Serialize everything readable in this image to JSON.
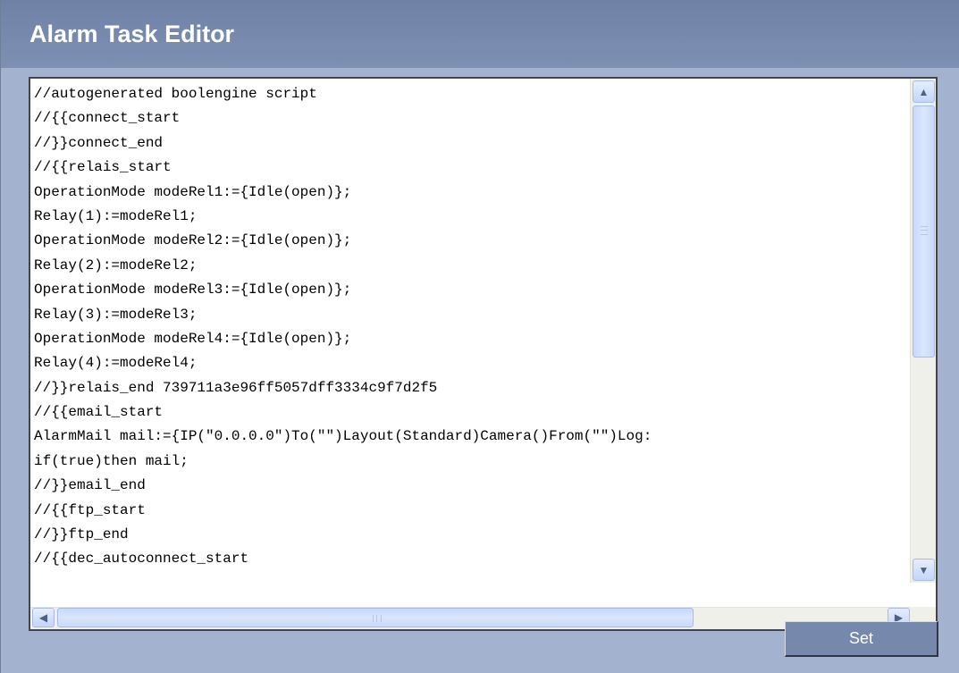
{
  "header": {
    "title": "Alarm Task Editor"
  },
  "editor": {
    "lines": [
      "//autogenerated boolengine script",
      "//{{connect_start",
      "//}}connect_end",
      "//{{relais_start",
      "OperationMode modeRel1:={Idle(open)};",
      "Relay(1):=modeRel1;",
      "OperationMode modeRel2:={Idle(open)};",
      "Relay(2):=modeRel2;",
      "OperationMode modeRel3:={Idle(open)};",
      "Relay(3):=modeRel3;",
      "OperationMode modeRel4:={Idle(open)};",
      "Relay(4):=modeRel4;",
      "//}}relais_end 739711a3e96ff5057dff3334c9f7d2f5",
      "//{{email_start",
      "AlarmMail mail:={IP(\"0.0.0.0\")To(\"\")Layout(Standard)Camera()From(\"\")Log:",
      "if(true)then mail;",
      "//}}email_end",
      "//{{ftp_start",
      "//}}ftp_end",
      "//{{dec_autoconnect_start"
    ]
  },
  "buttons": {
    "set_label": "Set"
  },
  "icons": {
    "scroll_up": "▲",
    "scroll_down": "▼",
    "scroll_left": "◀",
    "scroll_right": "▶"
  },
  "colors": {
    "header": "#7587aa",
    "background": "#a3b3cf",
    "button": "#7688ab"
  }
}
